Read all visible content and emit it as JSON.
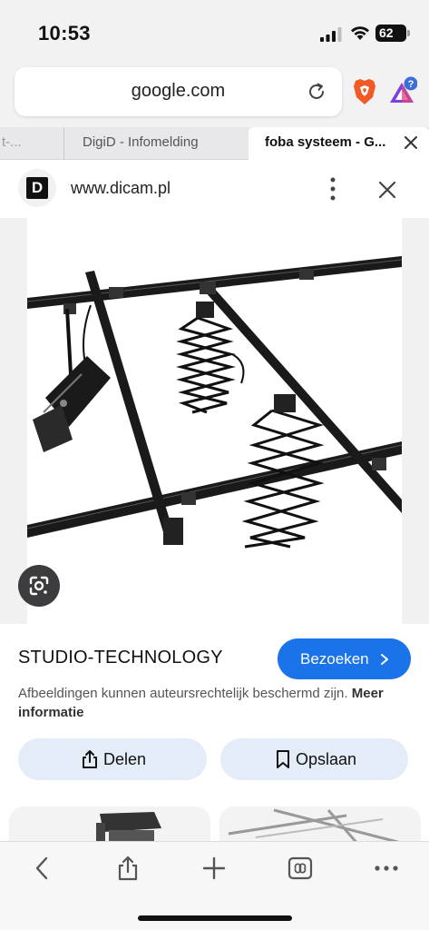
{
  "status": {
    "time": "10:53",
    "battery": "62"
  },
  "browser": {
    "url": "google.com",
    "tabs": [
      {
        "label": "t-..."
      },
      {
        "label": "DigiD - Infomelding"
      },
      {
        "label": "foba systeem - G..."
      }
    ],
    "rewards_badge": "?"
  },
  "site": {
    "favicon_letter": "D",
    "name": "www.dicam.pl"
  },
  "result": {
    "title": "STUDIO-TECHNOLOGY",
    "visit_label": "Bezoeken",
    "copyright_text": "Afbeeldingen kunnen auteursrechtelijk beschermd zijn.",
    "more_info_label": "Meer informatie",
    "share_label": "Delen",
    "save_label": "Opslaan"
  },
  "colors": {
    "accent": "#1a73e8",
    "pill_bg": "#e4ecf8",
    "brave_orange": "#f15a24",
    "rewards_purple": "#7b3fe4"
  },
  "icons": [
    "signal-icon",
    "wifi-icon",
    "battery-icon",
    "reload-icon",
    "brave-shield-icon",
    "brave-rewards-icon",
    "close-icon",
    "more-vert-icon",
    "google-lens-icon",
    "chevron-right-icon",
    "share-icon",
    "bookmark-icon",
    "back-icon",
    "add-icon",
    "tabs-icon",
    "more-horiz-icon"
  ]
}
